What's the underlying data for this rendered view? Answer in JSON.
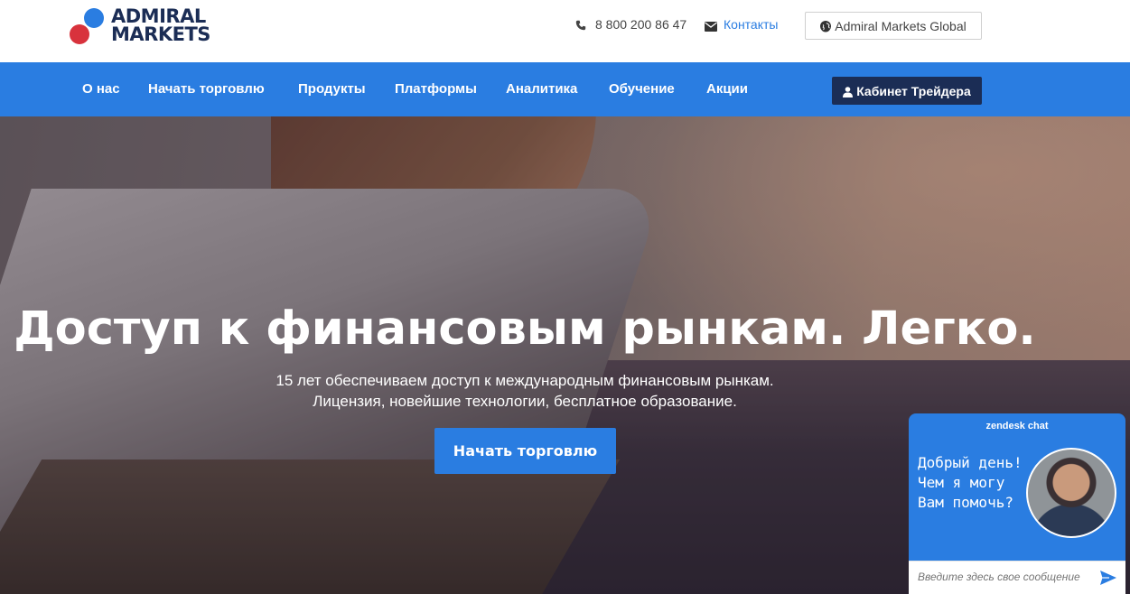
{
  "header": {
    "logo": {
      "line1": "ADMIRAL",
      "line2": "MARKETS"
    },
    "phone": "8 800 200 86 47",
    "contacts_label": "Контакты",
    "global_label": "Admiral Markets Global"
  },
  "nav": {
    "items": [
      {
        "label": "О нас"
      },
      {
        "label": "Начать торговлю"
      },
      {
        "label": "Продукты"
      },
      {
        "label": "Платформы"
      },
      {
        "label": "Аналитика"
      },
      {
        "label": "Обучение"
      },
      {
        "label": "Акции"
      }
    ],
    "cabinet_label": "Кабинет Трейдера"
  },
  "hero": {
    "title": "Доступ к финансовым рынкам. Легко.",
    "subtitle_line1": "15 лет обеспечиваем доступ к международным финансовым рынкам.",
    "subtitle_line2": "Лицензия, новейшие технологии, бесплатное образование.",
    "cta_label": "Начать торговлю"
  },
  "chat": {
    "brand": "zendesk chat",
    "message": "Добрый день! Чем я могу Вам помочь?",
    "input_placeholder": "Введите здесь свое сообщение"
  },
  "colors": {
    "brand_blue": "#2a7de1",
    "brand_navy": "#1b2d55",
    "brand_red": "#d8323c"
  }
}
